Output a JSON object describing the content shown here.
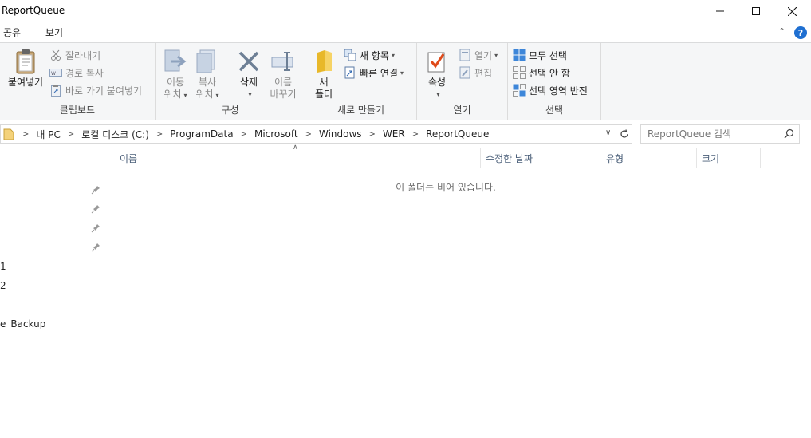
{
  "window": {
    "title": "ReportQueue",
    "minimize": "—",
    "maximize": "☐",
    "close": "✕"
  },
  "tabs": [
    {
      "label": "공유"
    },
    {
      "label": "보기"
    }
  ],
  "ribbon": {
    "clipboard": {
      "group_label": "클립보드",
      "paste": "붙여넣기",
      "cut": "잘라내기",
      "copy_path": "경로 복사",
      "paste_shortcut": "바로 가기 붙여넣기"
    },
    "organize": {
      "group_label": "구성",
      "move_to": [
        "이동",
        "위치"
      ],
      "copy_to": [
        "복사",
        "위치"
      ],
      "delete": "삭제",
      "rename": [
        "이름",
        "바꾸기"
      ]
    },
    "new": {
      "group_label": "새로 만들기",
      "new_folder": [
        "새",
        "폴더"
      ],
      "new_item": "새 항목",
      "easy_access": "빠른 연결"
    },
    "open": {
      "group_label": "열기",
      "properties": "속성",
      "open": "열기",
      "edit": "편집"
    },
    "select": {
      "group_label": "선택",
      "select_all": "모두 선택",
      "select_none": "선택 안 함",
      "invert": "선택 영역 반전"
    }
  },
  "address": {
    "breadcrumb": [
      "내 PC",
      "로컬 디스크 (C:)",
      "ProgramData",
      "Microsoft",
      "Windows",
      "WER",
      "ReportQueue"
    ],
    "search_placeholder": "ReportQueue 검색"
  },
  "nav": {
    "items": [
      "1",
      "2",
      "e_Backup"
    ]
  },
  "list": {
    "columns": [
      "이름",
      "수정한 날짜",
      "유형",
      "크기"
    ],
    "empty_message": "이 폴더는 비어 있습니다."
  },
  "colors": {
    "accent": "#1f6fd1",
    "ribbon_bg": "#f5f6f7",
    "header_text": "#4c607a"
  }
}
